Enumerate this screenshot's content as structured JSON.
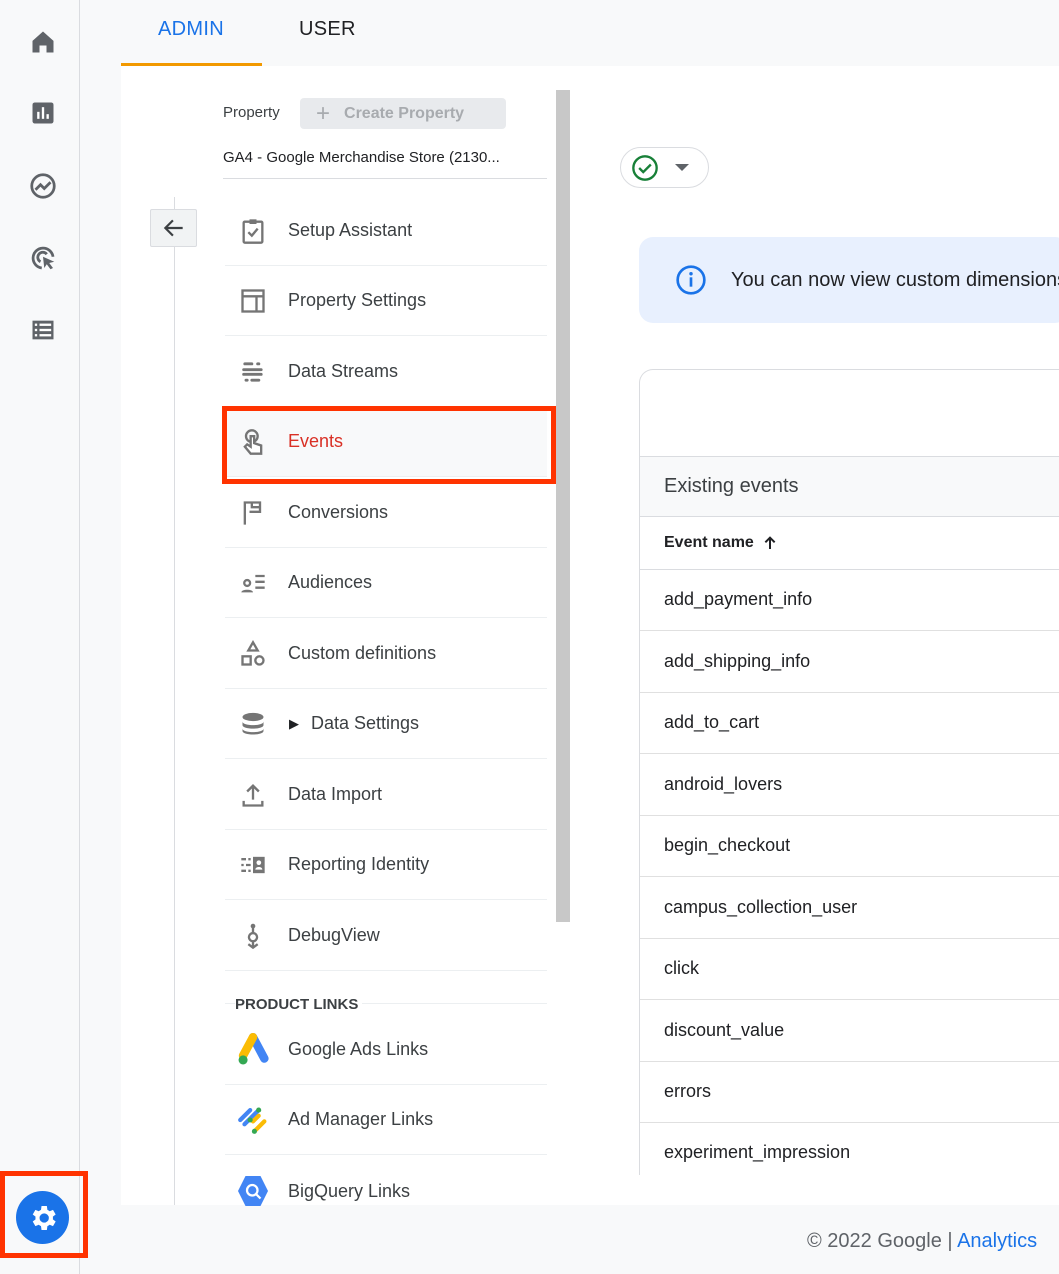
{
  "rail": {
    "items": [
      "home-icon",
      "reports-icon",
      "explore-icon",
      "advertising-icon",
      "configure-icon"
    ],
    "admin": "gear-icon"
  },
  "tabs": [
    {
      "label": "ADMIN",
      "active": true
    },
    {
      "label": "USER",
      "active": false
    }
  ],
  "property": {
    "label": "Property",
    "create_label": "Create Property",
    "name": "GA4 - Google Merchandise Store (2130..."
  },
  "nav": {
    "items": [
      {
        "label": "Setup Assistant",
        "icon": "clipboard-check-icon"
      },
      {
        "label": "Property Settings",
        "icon": "layout-icon"
      },
      {
        "label": "Data Streams",
        "icon": "streams-icon"
      },
      {
        "label": "Events",
        "icon": "touch-icon",
        "selected": true
      },
      {
        "label": "Conversions",
        "icon": "flag-icon"
      },
      {
        "label": "Audiences",
        "icon": "audience-icon"
      },
      {
        "label": "Custom definitions",
        "icon": "shapes-icon"
      },
      {
        "label": "Data Settings",
        "icon": "database-icon",
        "expandable": true
      },
      {
        "label": "Data Import",
        "icon": "upload-icon"
      },
      {
        "label": "Reporting Identity",
        "icon": "identity-icon"
      },
      {
        "label": "DebugView",
        "icon": "debug-icon"
      }
    ],
    "section": "PRODUCT LINKS",
    "links": [
      {
        "label": "Google Ads Links",
        "icon": "google-ads-icon"
      },
      {
        "label": "Ad Manager Links",
        "icon": "ad-manager-icon"
      },
      {
        "label": "BigQuery Links",
        "icon": "bigquery-icon"
      }
    ]
  },
  "banner": {
    "text": "You can now view custom dimensions"
  },
  "events": {
    "title": "Existing events",
    "column": "Event name",
    "rows": [
      "add_payment_info",
      "add_shipping_info",
      "add_to_cart",
      "android_lovers",
      "begin_checkout",
      "campus_collection_user",
      "click",
      "discount_value",
      "errors",
      "experiment_impression"
    ]
  },
  "footer": {
    "copyright": "© 2022 Google",
    "separator": "|",
    "link": "Analytics"
  },
  "colors": {
    "accent": "#1a73e8",
    "tab_underline": "#f29900",
    "highlight": "#ff3300",
    "selected_text": "#d93025",
    "success": "#188038"
  }
}
